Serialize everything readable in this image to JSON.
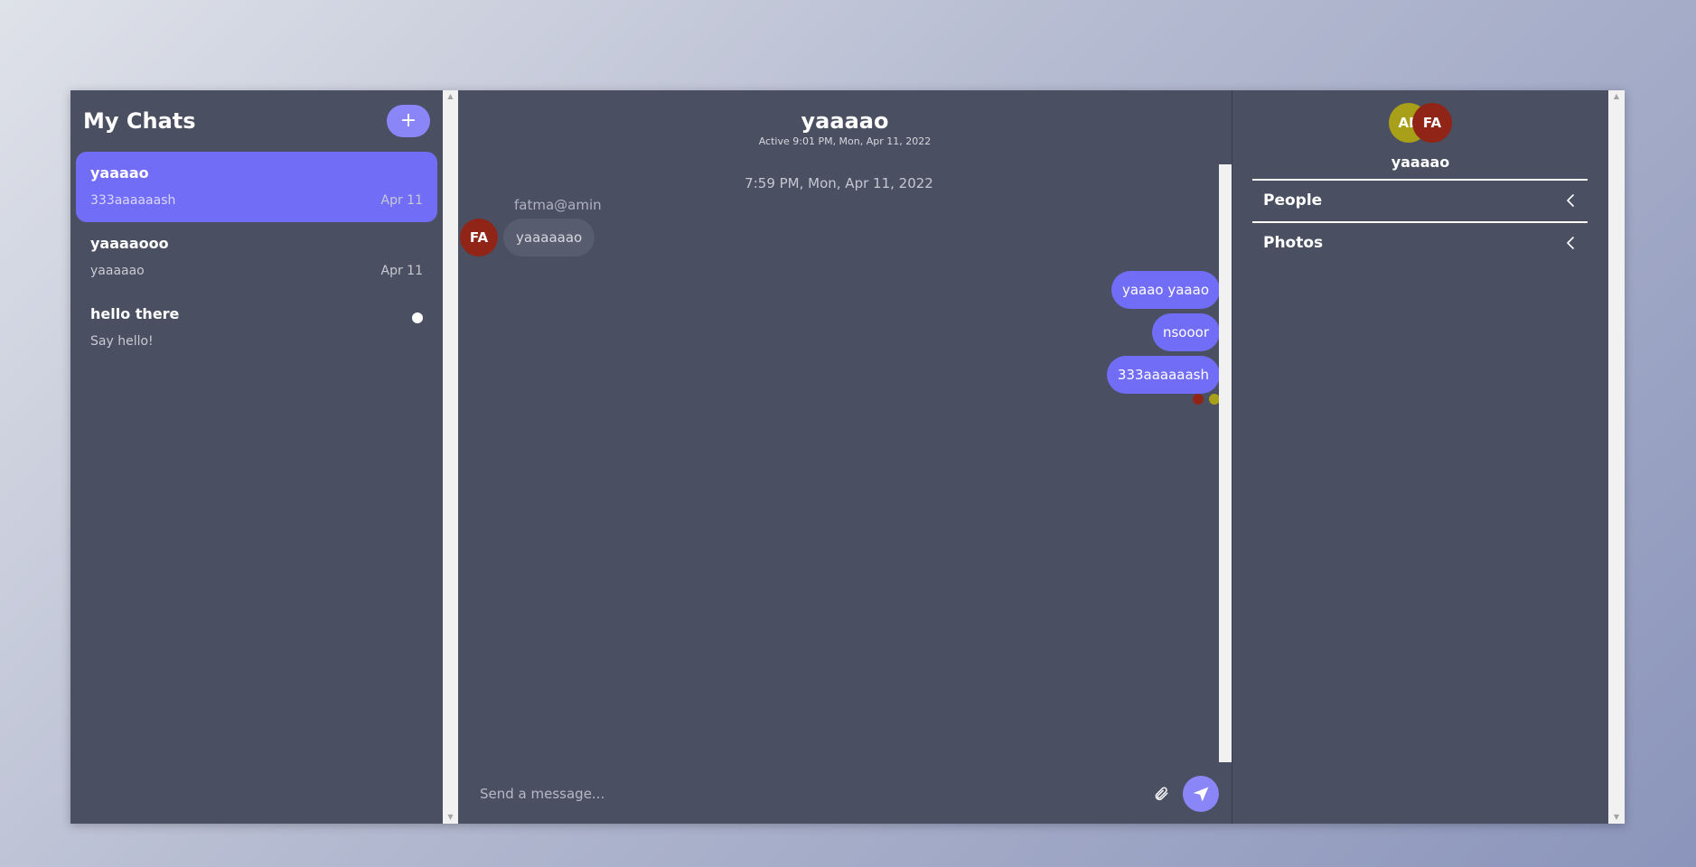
{
  "left_panel": {
    "title": "My Chats",
    "new_chat_icon": "plus-icon",
    "new_chat_label": "+",
    "chats": [
      {
        "title": "yaaaao",
        "last_message": "333aaaaaash",
        "date": "Apr 11",
        "active": true
      },
      {
        "title": "yaaaaooo",
        "last_message": "yaaaaao",
        "date": "Apr 11",
        "active": false
      },
      {
        "title": "hello there",
        "last_message": "Say hello!",
        "date": "",
        "unread": true
      }
    ]
  },
  "conversation": {
    "title": "yaaaao",
    "active_status": "Active 9:01 PM, Mon, Apr 11, 2022",
    "timestamp": "7:59 PM, Mon, Apr 11, 2022",
    "incoming": {
      "sender": "fatma@amin",
      "avatar_initials": "FA",
      "text": "yaaaaaao"
    },
    "outgoing": [
      "yaaao yaaao",
      "nsooor",
      "333aaaaaash"
    ],
    "read_receipts": [
      {
        "color": "#8f2417"
      },
      {
        "color": "#a8a019"
      }
    ],
    "composer": {
      "placeholder": "Send a message...",
      "attach_icon": "paperclip-icon",
      "send_icon": "send-icon"
    }
  },
  "details_panel": {
    "members": [
      {
        "initials": "AB",
        "color": "#a8a019"
      },
      {
        "initials": "FA",
        "color": "#8f2417"
      }
    ],
    "room_name": "yaaaao",
    "sections": [
      {
        "label": "People",
        "icon": "chevron-left-icon"
      },
      {
        "label": "Photos",
        "icon": "chevron-left-icon"
      }
    ]
  },
  "colors": {
    "accent": "#726df7",
    "button": "#8b86f7",
    "panel": "#4a5061"
  }
}
